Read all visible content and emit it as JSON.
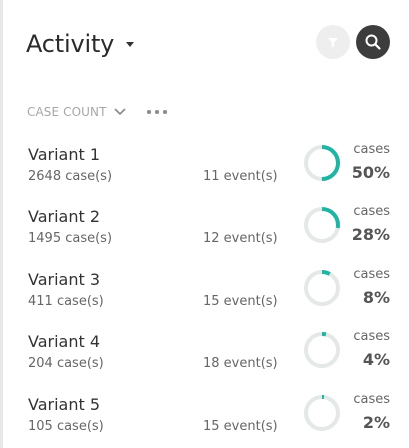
{
  "header": {
    "title": "Activity"
  },
  "sort": {
    "label": "CASE COUNT"
  },
  "colors": {
    "accent": "#1fb5a5",
    "track": "#e4e8e7",
    "search_bg": "#3d3d3d",
    "filter_bg": "#eeeeee"
  },
  "variants": [
    {
      "name": "Variant 1",
      "cases": "2648 case(s)",
      "events": "11 event(s)",
      "cases_label": "cases",
      "percent_text": "50%",
      "share": 0.5
    },
    {
      "name": "Variant 2",
      "cases": "1495 case(s)",
      "events": "12 event(s)",
      "cases_label": "cases",
      "percent_text": "28%",
      "share": 0.28
    },
    {
      "name": "Variant 3",
      "cases": "411 case(s)",
      "events": "15 event(s)",
      "cases_label": "cases",
      "percent_text": "8%",
      "share": 0.08
    },
    {
      "name": "Variant 4",
      "cases": "204 case(s)",
      "events": "18 event(s)",
      "cases_label": "cases",
      "percent_text": "4%",
      "share": 0.04
    },
    {
      "name": "Variant 5",
      "cases": "105 case(s)",
      "events": "15 event(s)",
      "cases_label": "cases",
      "percent_text": "2%",
      "share": 0.02
    }
  ]
}
